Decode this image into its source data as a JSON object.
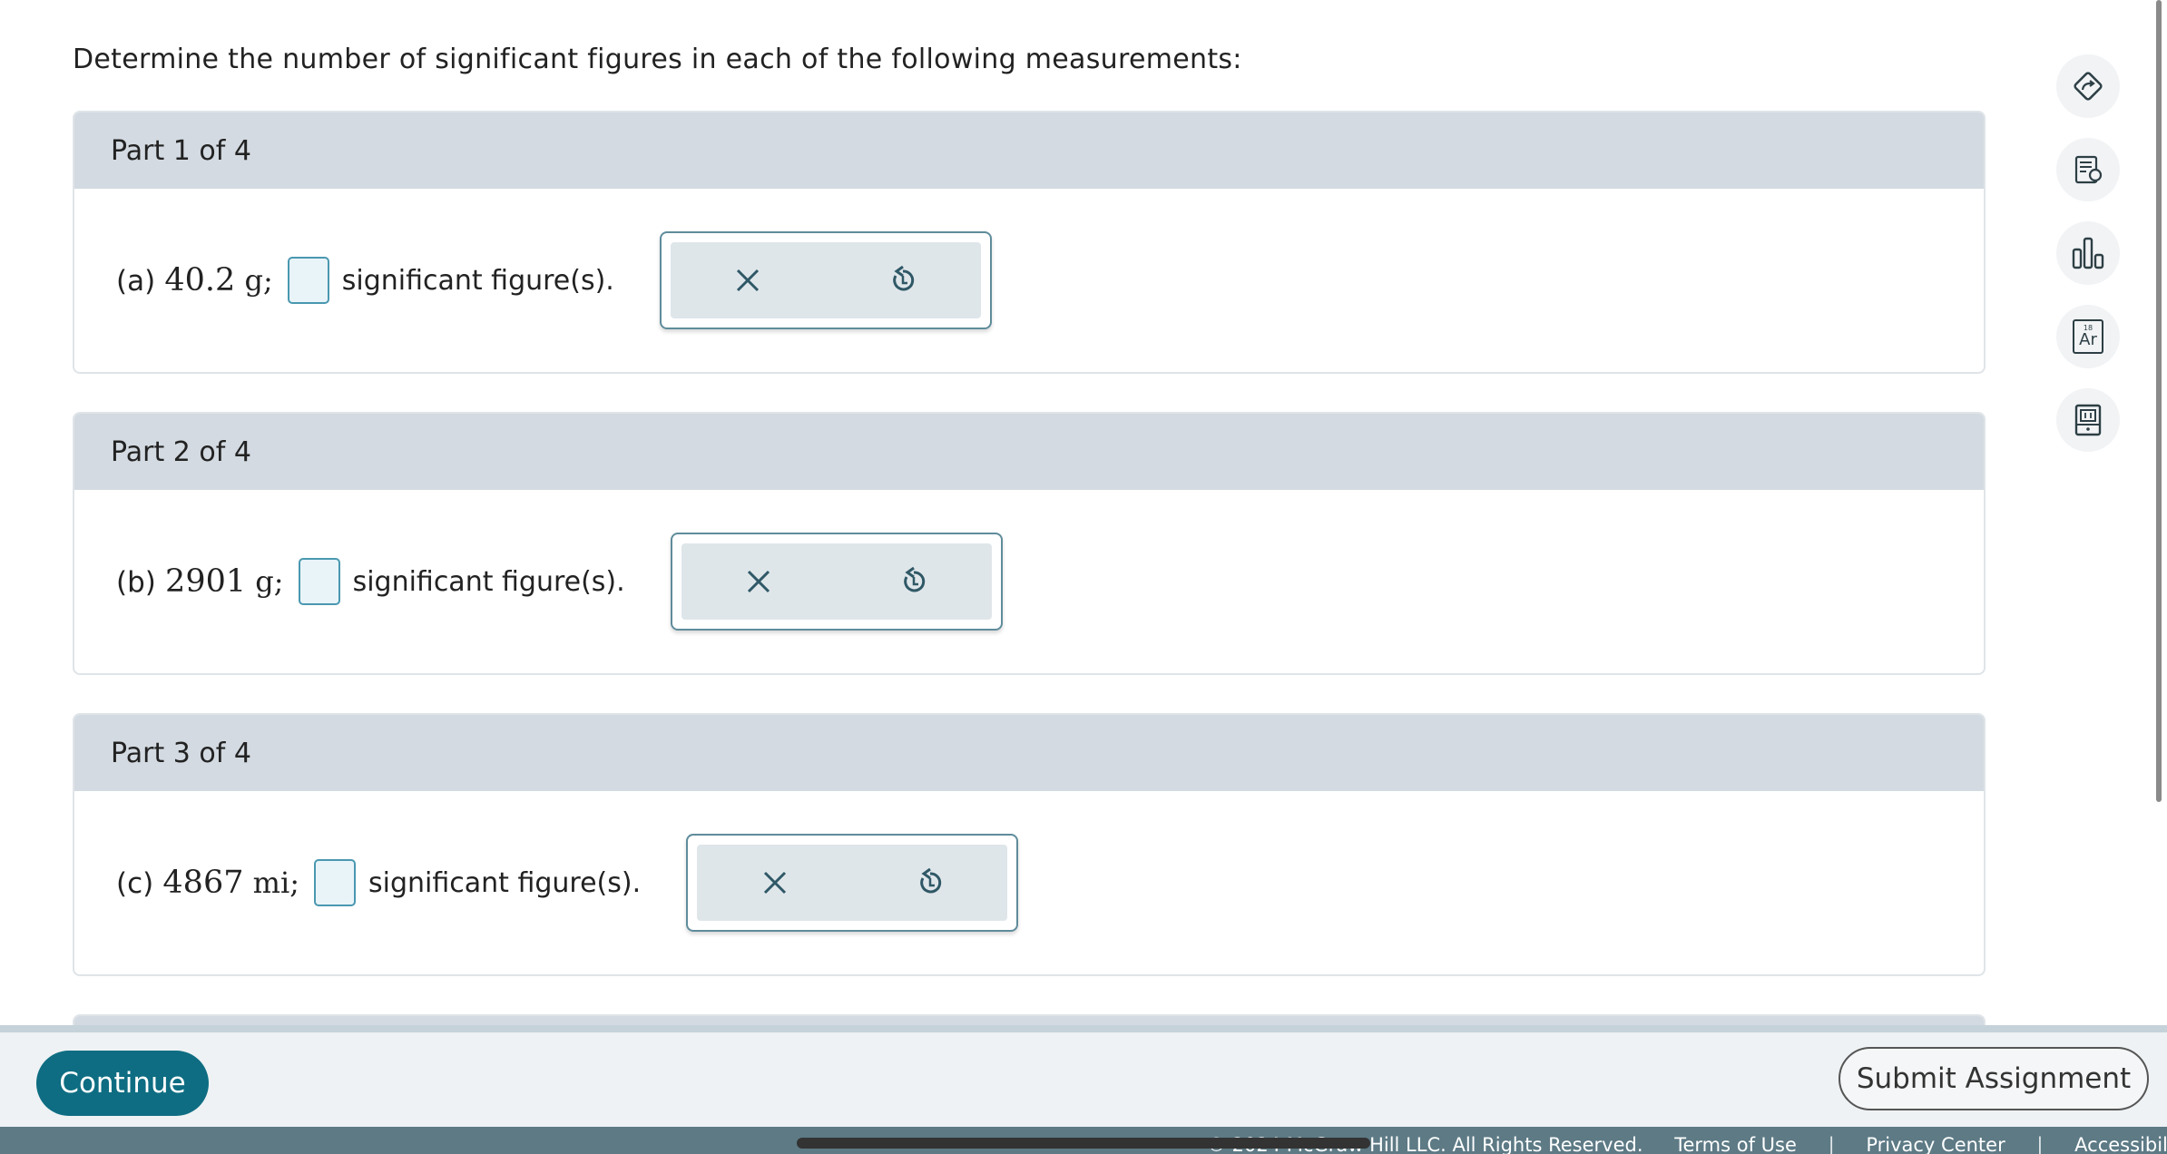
{
  "prompt": "Determine the number of significant figures in each of the following measurements:",
  "parts": [
    {
      "header": "Part 1 of 4",
      "letter": "(a)",
      "value": "40.2",
      "unit": "g;",
      "suffix": "significant figure(s)."
    },
    {
      "header": "Part 2 of 4",
      "letter": "(b)",
      "value": "2901",
      "unit": "g;",
      "suffix": "significant figure(s)."
    },
    {
      "header": "Part 3 of 4",
      "letter": "(c)",
      "value": "4867",
      "unit": "mi;",
      "suffix": "significant figure(s)."
    }
  ],
  "side_tools": [
    "guided-solution-icon",
    "hint-icon",
    "data-chart-icon",
    "periodic-table-icon",
    "calculator-icon"
  ],
  "periodic_icon": {
    "number": "18",
    "symbol": "Ar"
  },
  "footer": {
    "continue_label": "Continue",
    "submit_label": "Submit Assignment",
    "legal_text": "© 2024 McGraw Hill LLC. All Rights Reserved.",
    "links": [
      "Terms of Use",
      "Privacy Center",
      "Accessibility"
    ]
  },
  "colors": {
    "accent": "#0e6d82",
    "header_bg": "#d3dae1",
    "input_border": "#4a98b0"
  }
}
